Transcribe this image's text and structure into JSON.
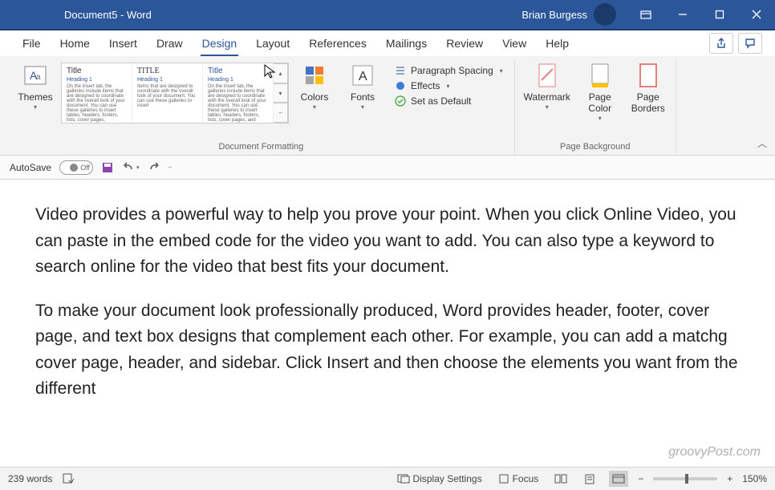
{
  "titleBar": {
    "title": "Document5  -  Word",
    "user": "Brian Burgess"
  },
  "tabs": {
    "items": [
      "File",
      "Home",
      "Insert",
      "Draw",
      "Design",
      "Layout",
      "References",
      "Mailings",
      "Review",
      "View",
      "Help"
    ],
    "active": "Design"
  },
  "ribbon": {
    "themes": {
      "label": "Themes"
    },
    "gallery": {
      "card1": {
        "title": "Title",
        "heading": "Heading 1",
        "lorem": "On the Insert tab, the galleries include items that are designed to coordinate with the overall look of your document. You can use these galleries to insert tables, headers, footers, lists, cover pages,"
      },
      "card2": {
        "title": "TITLE",
        "heading": "Heading 1",
        "lorem": "Items that are designed to coordinate with the overall look of your document. You can use these galleries to insert"
      },
      "card3": {
        "title": "Title",
        "heading": "Heading 1",
        "lorem": "On the Insert tab, the galleries include items that are designed to coordinate with the overall look of your document. You can use these galleries to insert tables, headers, footers, lists, cover pages, and other"
      }
    },
    "colors": {
      "label": "Colors"
    },
    "fonts": {
      "label": "Fonts"
    },
    "paragraphSpacing": "Paragraph Spacing",
    "effects": "Effects",
    "setDefault": "Set as Default",
    "watermark": {
      "label": "Watermark"
    },
    "pageColor": {
      "label": "Page Color"
    },
    "pageBorders": {
      "label": "Page Borders"
    },
    "groupDocFormatting": "Document Formatting",
    "groupPageBackground": "Page Background"
  },
  "qat": {
    "autosave": "AutoSave",
    "toggleState": "Off"
  },
  "document": {
    "p1": "Video provides a powerful way to help you prove your point. When you click Online Video, you can paste in the embed code for the video you want to add. You can also type a keyword to search online for the video that best fits your document.",
    "p2": "To make your document look professionally produced, Word provides header, footer, cover page, and text box designs that complement each other. For example, you can add a matchg cover page, header, and sidebar. Click Insert and then choose the elements you want from the different"
  },
  "status": {
    "wordCount": "239 words",
    "displaySettings": "Display Settings",
    "focus": "Focus",
    "zoom": "150%"
  },
  "watermarkText": "groovyPost.com"
}
